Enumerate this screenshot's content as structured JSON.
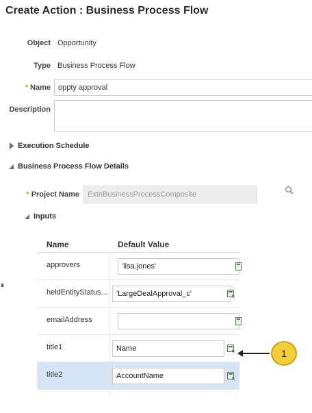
{
  "page": {
    "title": "Create Action : Business Process Flow"
  },
  "form": {
    "object_label": "Object",
    "object_value": "Opportunity",
    "type_label": "Type",
    "type_value": "Business Process Flow",
    "name_required": "*",
    "name_label": "Name",
    "name_value": "oppty approval",
    "description_label": "Description",
    "description_value": ""
  },
  "sections": {
    "execution_schedule": "Execution Schedule",
    "bpf_details": "Business Process Flow Details",
    "project_required": "*",
    "project_label": "Project Name",
    "project_value": "ExtnBusinessProcessComposite",
    "inputs": "Inputs"
  },
  "table": {
    "headers": [
      "Name",
      "Default Value"
    ],
    "rows": [
      {
        "name": "approvers",
        "value": "'lisa.jones'"
      },
      {
        "name": "heldEntityStatus...",
        "value": "'LargeDealApproval_c'"
      },
      {
        "name": "emailAddress",
        "value": ""
      },
      {
        "name": "title1",
        "value": "Name"
      },
      {
        "name": "title2",
        "value": "AccountName"
      }
    ],
    "selected_row": "title2"
  },
  "callout": {
    "number": "1"
  },
  "colors": {
    "callout": "#f4ce3a",
    "selected_row": "#d6e5f5",
    "required": "#d4a017"
  },
  "icons": [
    "triangle-right-icon",
    "triangle-down-icon",
    "search-icon",
    "expression-builder-icon",
    "arrow-icon"
  ]
}
